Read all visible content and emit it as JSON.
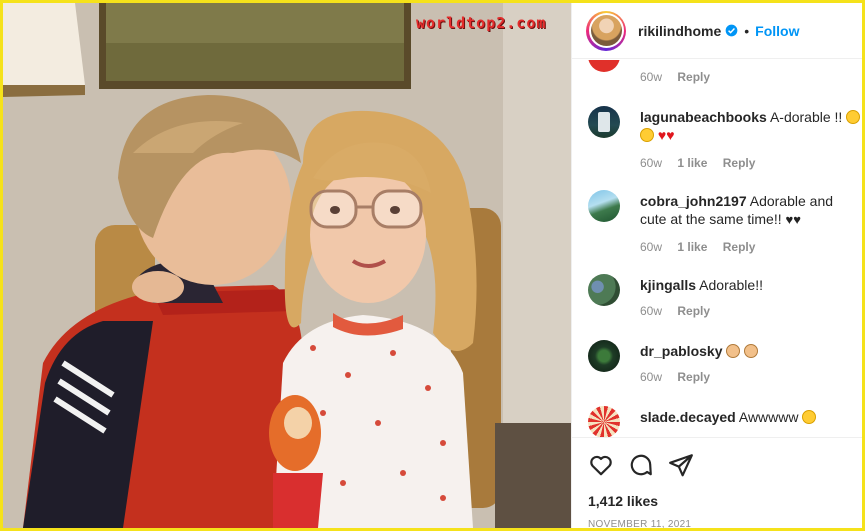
{
  "watermark": "worldtop2.com",
  "post": {
    "username": "rikilindhome",
    "follow_label": "Follow",
    "dot": "•",
    "likes": "1,412 likes",
    "date": "NOVEMBER 11, 2021"
  },
  "comments": [
    {
      "user": "",
      "text": "",
      "time": "60w",
      "likes": "",
      "reply": "Reply"
    },
    {
      "user": "lagunabeachbooks",
      "text": "A-dorable !!",
      "time": "60w",
      "likes": "1 like",
      "reply": "Reply"
    },
    {
      "user": "cobra_john2197",
      "text": "Adorable and cute at the same time!!",
      "time": "60w",
      "likes": "1 like",
      "reply": "Reply"
    },
    {
      "user": "kjingalls",
      "text": "Adorable!!",
      "time": "60w",
      "likes": "",
      "reply": "Reply"
    },
    {
      "user": "dr_pablosky",
      "text": "",
      "time": "60w",
      "likes": "",
      "reply": "Reply"
    },
    {
      "user": "slade.decayed",
      "text": "Awwwww",
      "time": "",
      "likes": "",
      "reply": ""
    }
  ],
  "icons": {
    "like": "heart-icon",
    "comment": "comment-icon",
    "share": "share-icon",
    "verified": "verified-badge-icon"
  },
  "colors": {
    "border": "#f5e21a",
    "follow": "#0095f6",
    "meta": "#8e8e8e",
    "text": "#262626"
  }
}
